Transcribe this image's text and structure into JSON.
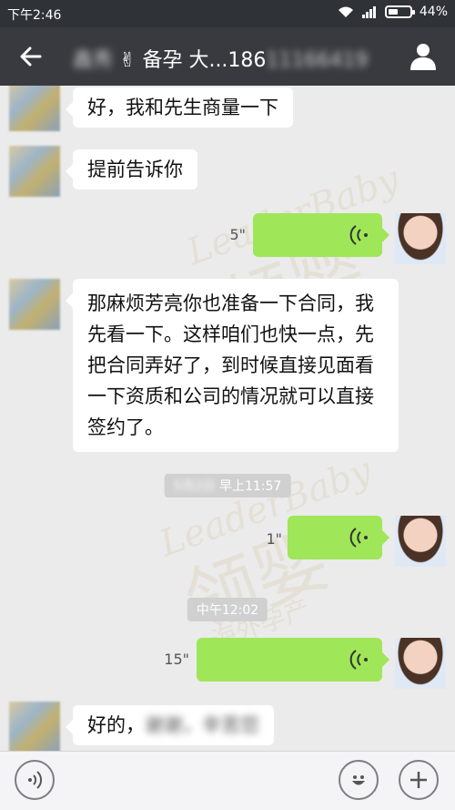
{
  "status_bar": {
    "time": "下午2:46",
    "battery": "44%",
    "battery_level": 0.44
  },
  "header": {
    "contact_name_blurred": "鑫秀",
    "contact_emoji": "✌",
    "title_text": "备孕 大...186",
    "title_tail_blurred": "11166419"
  },
  "watermark": {
    "brand_en": "LeaderBaby",
    "brand_cn": "领婴",
    "brand_sub": "海外孕产"
  },
  "messages": [
    {
      "side": "left",
      "type": "text",
      "text": "好，我和先生商量一下"
    },
    {
      "side": "left",
      "type": "text",
      "text": "提前告诉你"
    },
    {
      "side": "right",
      "type": "voice",
      "duration": "5\""
    },
    {
      "side": "left",
      "type": "text",
      "text": "那麻烦芳亮你也准备一下合同，我先看一下。这样咱们也快一点，先把合同弄好了，到时候直接见面看一下资质和公司的情况就可以直接签约了。"
    },
    {
      "type": "timestamp",
      "blurred": "5月2日",
      "text": "早上11:57"
    },
    {
      "side": "right",
      "type": "voice",
      "duration": "1\""
    },
    {
      "type": "timestamp",
      "text": "中午12:02"
    },
    {
      "side": "right",
      "type": "voice",
      "duration": "15\""
    },
    {
      "side": "left",
      "type": "text",
      "text": "好的，",
      "blurred": "谢谢，辛苦您"
    }
  ],
  "input_bar": {
    "voice_icon": "voice-input-icon",
    "emoji_icon": "emoji-icon",
    "more_icon": "plus-icon"
  }
}
